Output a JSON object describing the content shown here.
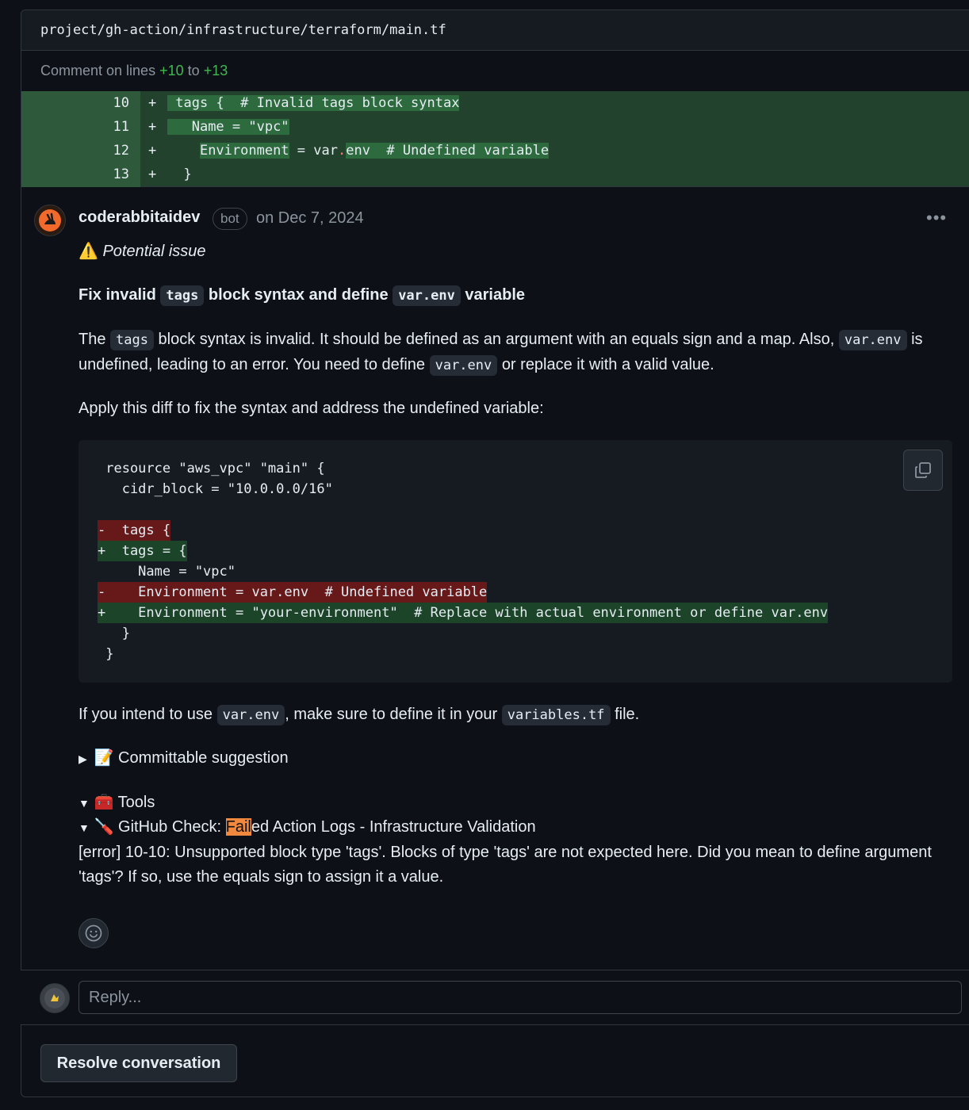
{
  "file": {
    "path": "project/gh-action/infrastructure/terraform/main.tf"
  },
  "line_comment": {
    "prefix": "Comment on lines",
    "from": "+10",
    "middle": "to",
    "to": "+13"
  },
  "diff_lines": [
    {
      "num": "10",
      "sign": "+"
    },
    {
      "num": "11",
      "sign": "+"
    },
    {
      "num": "12",
      "sign": "+"
    },
    {
      "num": "13",
      "sign": "+"
    }
  ],
  "diff_code": {
    "l10": "tags {  # Invalid tags block syntax",
    "l11": "Name = \"vpc\"",
    "l12_a": "Environment",
    "l12_b": " = ",
    "l12_c": "var",
    "l12_d": ".",
    "l12_e": "env  # Undefined variable",
    "l13": "}"
  },
  "comment": {
    "author": "coderabbitaidev",
    "badge": "bot",
    "date": "on Dec 7, 2024",
    "more": "•••",
    "warning_icon": "⚠️",
    "warning": "Potential issue",
    "title_a": "Fix invalid",
    "title_code1": "tags",
    "title_b": "block syntax and define",
    "title_code2": "var.env",
    "title_c": "variable",
    "p1_a": "The",
    "p1_code1": "tags",
    "p1_b": "block syntax is invalid. It should be defined as an argument with an equals sign and a map. Also,",
    "p1_code2": "var.env",
    "p1_c": "is undefined, leading to an error. You need to define",
    "p1_code3": "var.env",
    "p1_d": "or replace it with a valid value.",
    "p2": "Apply this diff to fix the syntax and address the undefined variable:",
    "code_lines": [
      " resource \"aws_vpc\" \"main\" {",
      "   cidr_block = \"10.0.0.0/16\"",
      "",
      "-  tags {",
      "+  tags = {",
      "     Name = \"vpc\"",
      "-    Environment = var.env  # Undefined variable",
      "+    Environment = \"your-environment\"  # Replace with actual environment or define var.env",
      "   }",
      " }"
    ],
    "p3_a": "If you intend to use",
    "p3_code1": "var.env",
    "p3_b": ", make sure to define it in your",
    "p3_code2": "variables.tf",
    "p3_c": "file.",
    "committable": "📝 Committable suggestion",
    "tools": "🧰 Tools",
    "check_icon": "🪛",
    "check_a": "GitHub Check: ",
    "check_hl": "Fail",
    "check_b": "ed Action Logs - Infrastructure Validation",
    "error": "[error] 10-10: Unsupported block type 'tags'. Blocks of type 'tags' are not expected here. Did you mean to define argument 'tags'? If so, use the equals sign to assign it a value."
  },
  "reply": {
    "placeholder": "Reply..."
  },
  "resolve": {
    "label": "Resolve conversation"
  }
}
